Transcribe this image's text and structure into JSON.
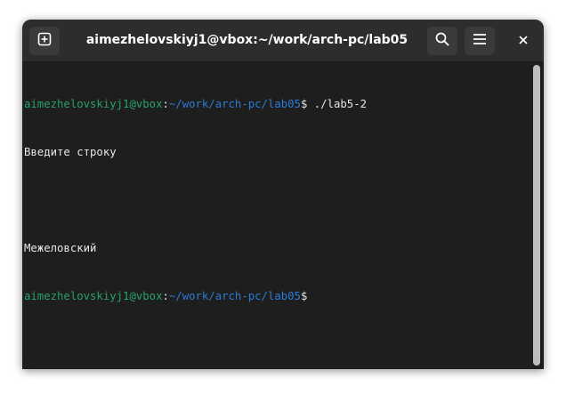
{
  "window": {
    "title": "aimezhelovskiyj1@vbox:~/work/arch-pc/lab05"
  },
  "headerbar": {
    "new_tab_icon": "new-tab-icon",
    "search_icon": "search-icon",
    "menu_icon": "hamburger-menu-icon",
    "close_icon": "close-icon"
  },
  "terminal": {
    "lines": [
      {
        "user_host": "aimezhelovskiyj1@vbox",
        "sep": ":",
        "path": "~/work/arch-pc/lab05",
        "prompt": "$",
        "command": " ./lab5-2"
      },
      {
        "text": "Введите строку"
      },
      {
        "text": ""
      },
      {
        "text": "Межеловский"
      },
      {
        "user_host": "aimezhelovskiyj1@vbox",
        "sep": ":",
        "path": "~/work/arch-pc/lab05",
        "prompt": "$",
        "command": ""
      }
    ]
  },
  "colors": {
    "user_host": "#26a269",
    "path": "#2a7bd6",
    "text": "#e6e6e6",
    "background": "#1e1e1e",
    "headerbar": "#2d2d2d"
  }
}
